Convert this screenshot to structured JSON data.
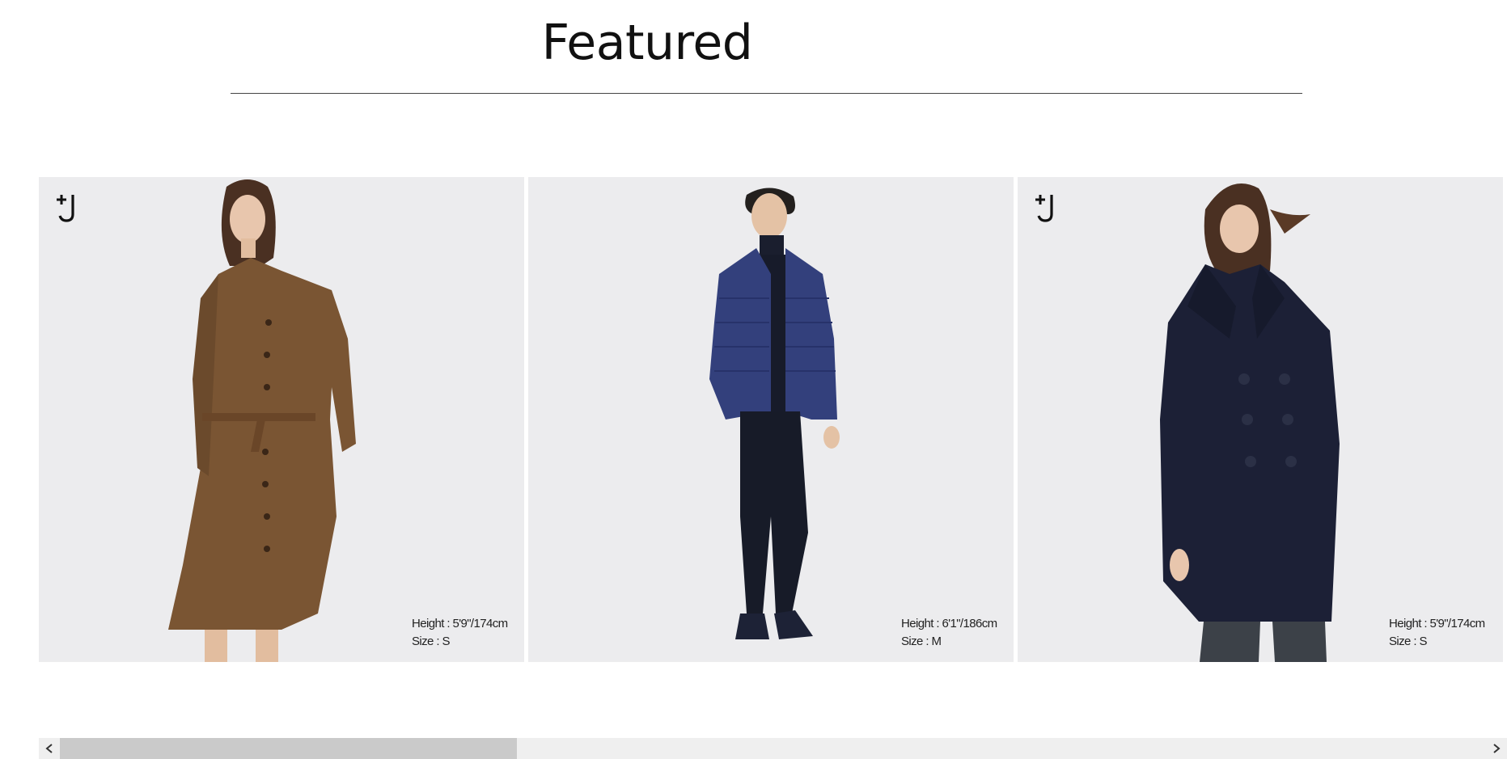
{
  "section": {
    "title": "Featured"
  },
  "cards": [
    {
      "brand_icon": "plus-j-logo-icon",
      "show_brand": true,
      "height_label": "Height : 5'9\"/174cm",
      "size_label": "Size : S",
      "garment_color": "#7a5533",
      "description": "model in brown belted shirt dress"
    },
    {
      "brand_icon": "",
      "show_brand": false,
      "height_label": "Height : 6'1\"/186cm",
      "size_label": "Size : M",
      "garment_color": "#33407c",
      "description": "model in navy puffer jacket and dark trousers"
    },
    {
      "brand_icon": "plus-j-logo-icon",
      "show_brand": true,
      "height_label": "Height : 5'9\"/174cm",
      "size_label": "Size : S",
      "garment_color": "#1c2036",
      "description": "model in navy double-breasted coat"
    }
  ],
  "scrollbar": {
    "left_icon": "chevron-left-icon",
    "right_icon": "chevron-right-icon",
    "position_fraction": 0.0,
    "visible_fraction": 0.32
  },
  "colors": {
    "photo_background": "#ececee",
    "skin": "#e8c6ad",
    "hair": "#4a3022",
    "trousers": "#171b28"
  }
}
